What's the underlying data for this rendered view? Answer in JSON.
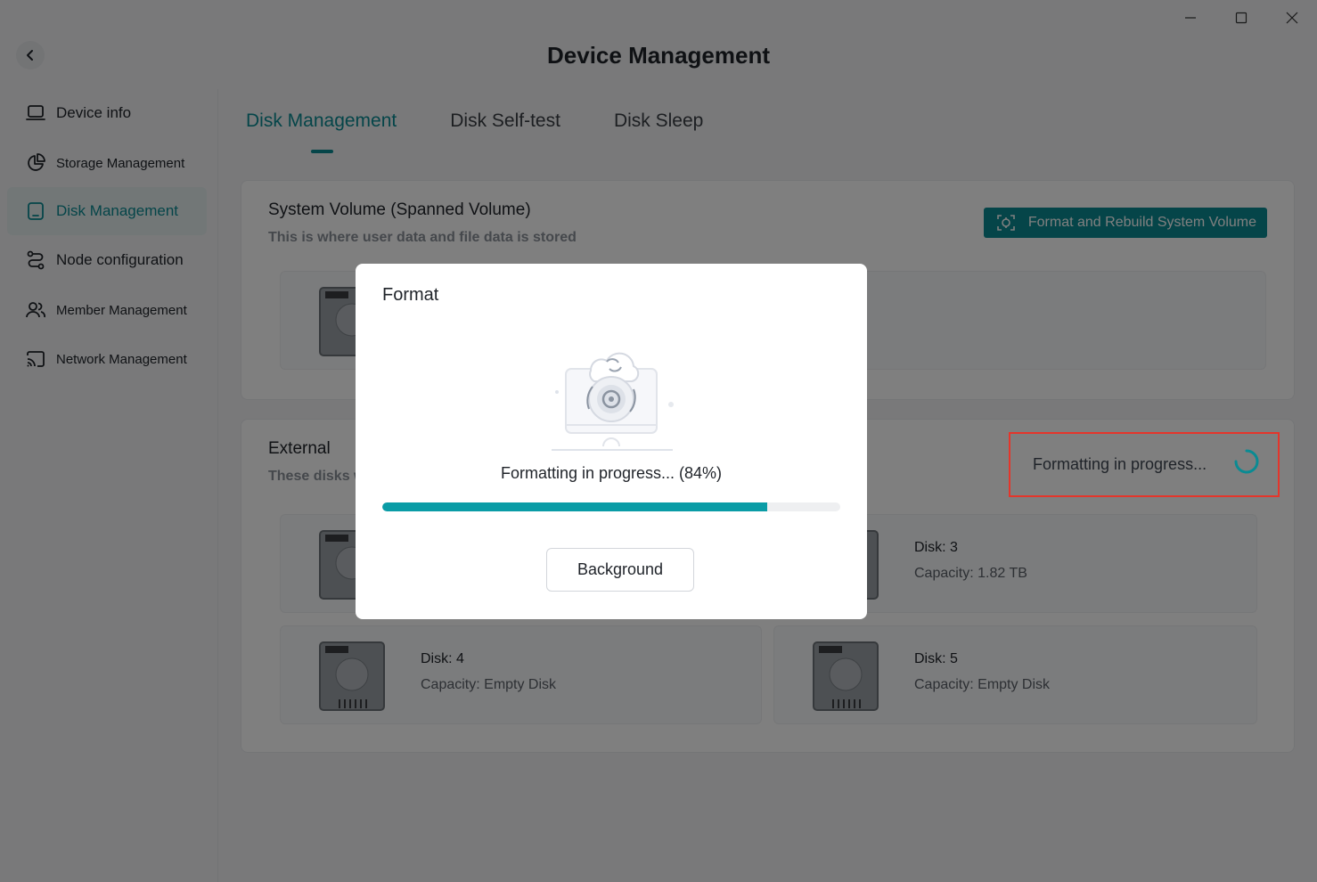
{
  "window": {
    "title": "Device Management",
    "controls": [
      "minimize-icon",
      "maximize-icon",
      "close-icon"
    ]
  },
  "sidebar": {
    "items": [
      {
        "label": "Device info",
        "icon": "laptop-icon",
        "active": false
      },
      {
        "label": "Storage Management",
        "icon": "pie-chart-icon",
        "active": false
      },
      {
        "label": "Disk Management",
        "icon": "disk-icon",
        "active": true
      },
      {
        "label": "Node configuration",
        "icon": "route-icon",
        "active": false
      },
      {
        "label": "Member Management",
        "icon": "users-icon",
        "active": false
      },
      {
        "label": "Network Management",
        "icon": "cast-icon",
        "active": false
      }
    ]
  },
  "tabs": [
    {
      "label": "Disk Management",
      "active": true
    },
    {
      "label": "Disk Self-test",
      "active": false
    },
    {
      "label": "Disk Sleep",
      "active": false
    }
  ],
  "system_volume": {
    "title": "System Volume (Spanned Volume)",
    "subtitle": "This is where user data and file data is stored",
    "rebuild_button": "Format and Rebuild System Volume"
  },
  "external": {
    "title": "External",
    "subtitle": "These disks w",
    "status": "Formatting in progress...",
    "disks": [
      {
        "name": "Disk: 3",
        "capacity": "Capacity: 1.82 TB"
      },
      {
        "name": "Disk: 4",
        "capacity": "Capacity: Empty Disk"
      },
      {
        "name": "Disk: 5",
        "capacity": "Capacity: Empty Disk"
      }
    ]
  },
  "modal": {
    "title": "Format",
    "status": "Formatting in progress... (84%)",
    "progress": 0.84,
    "button": "Background"
  },
  "colors": {
    "accent": "#0a8b93",
    "progress": "#0a9ca6",
    "highlight": "#e5352b"
  }
}
